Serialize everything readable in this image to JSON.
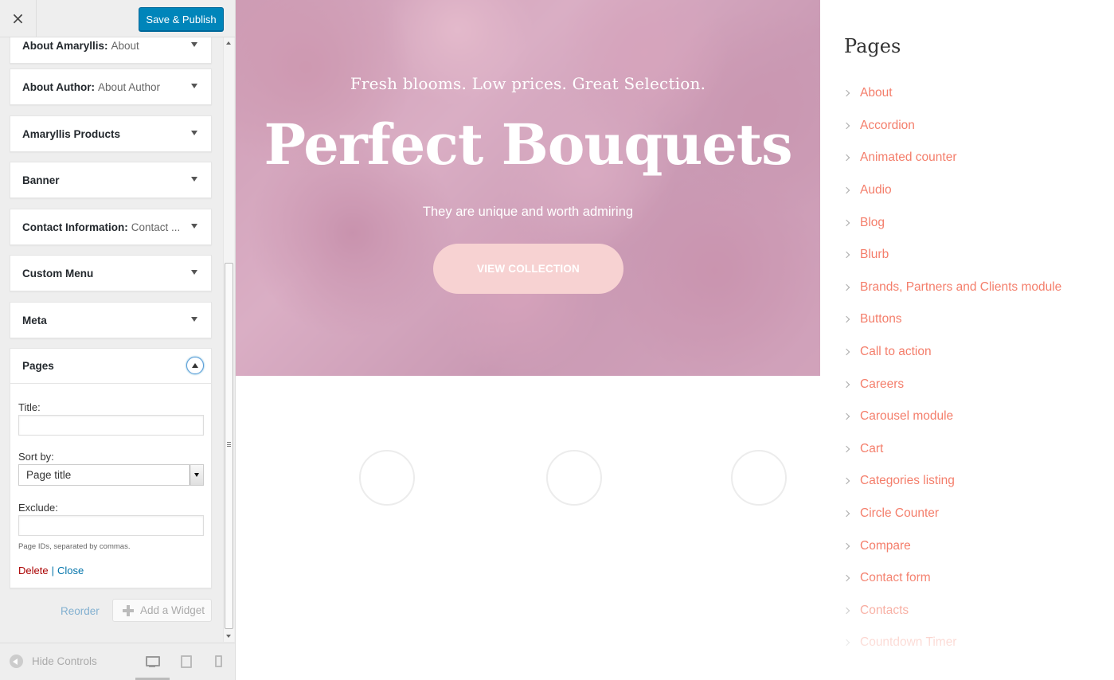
{
  "topbar": {
    "close_icon": "×",
    "publish_label": "Save & Publish"
  },
  "widgets": [
    {
      "title": "About Amaryllis:",
      "subtitle": "About"
    },
    {
      "title": "About Author:",
      "subtitle": "About Author"
    },
    {
      "title": "Amaryllis Products",
      "subtitle": ""
    },
    {
      "title": "Banner",
      "subtitle": ""
    },
    {
      "title": "Contact Information:",
      "subtitle": "Contact ..."
    },
    {
      "title": "Custom Menu",
      "subtitle": ""
    },
    {
      "title": "Meta",
      "subtitle": ""
    },
    {
      "title": "Pages",
      "subtitle": ""
    }
  ],
  "pages_form": {
    "title_label": "Title:",
    "title_value": "",
    "sort_label": "Sort by:",
    "sort_value": "Page title",
    "exclude_label": "Exclude:",
    "exclude_value": "",
    "hint": "Page IDs, separated by commas.",
    "delete_label": "Delete",
    "separator": "|",
    "close_label": "Close"
  },
  "panel_actions": {
    "reorder_label": "Reorder",
    "add_widget_label": "Add a Widget"
  },
  "footer": {
    "hide_controls_label": "Hide Controls"
  },
  "hero": {
    "tagline": "Fresh blooms.  Low prices.  Great Selection.",
    "title": "Perfect Bouquets",
    "subtitle": "They are unique and worth admiring",
    "button_label": "VIEW COLLECTION"
  },
  "pages_widget": {
    "title": "Pages",
    "items": [
      "About",
      "Accordion",
      "Animated counter",
      "Audio",
      "Blog",
      "Blurb",
      "Brands, Partners and Clients module",
      "Buttons",
      "Call to action",
      "Careers",
      "Carousel module",
      "Cart",
      "Categories listing",
      "Circle Counter",
      "Compare",
      "Contact form",
      "Contacts",
      "Countdown Timer"
    ]
  },
  "colors": {
    "publish_blue": "#0085ba",
    "link_coral": "#f47e6b",
    "delete_red": "#aa0000"
  }
}
